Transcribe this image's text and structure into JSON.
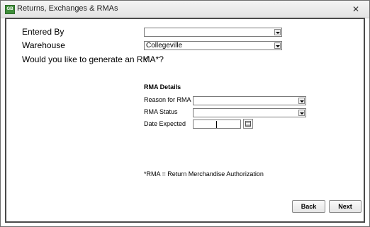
{
  "window": {
    "title": "Returns, Exchanges & RMAs",
    "close_glyph": "✕",
    "app_icon": "app-icon",
    "app_icon_text": "GB"
  },
  "form": {
    "entered_by": {
      "label": "Entered By",
      "value": ""
    },
    "warehouse": {
      "label": "Warehouse",
      "value": "Collegeville"
    },
    "generate_rma": {
      "label": "Would you like to generate an RMA*?",
      "checked_glyph": "✓"
    }
  },
  "rma_details": {
    "heading": "RMA Details",
    "reason": {
      "label": "Reason for RMA",
      "value": ""
    },
    "status": {
      "label": "RMA Status",
      "value": ""
    },
    "date_expected": {
      "label": "Date Expected"
    },
    "footnote": "*RMA = Return Merchandise Authorization"
  },
  "buttons": {
    "back": "Back",
    "next": "Next"
  }
}
